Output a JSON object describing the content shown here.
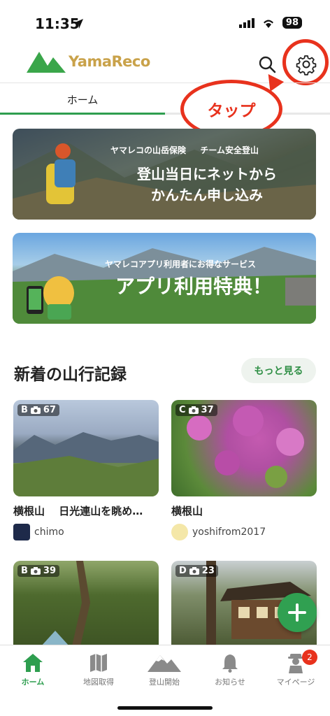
{
  "status": {
    "time": "11:35",
    "battery": "98"
  },
  "header": {
    "logo_text": "YamaReco"
  },
  "tabs": {
    "home": "ホーム"
  },
  "callout": {
    "text": "タップ"
  },
  "banners": {
    "insurance": {
      "sub": "ヤマレコの山岳保険 　 チーム安全登山",
      "main_line1": "登山当日にネットから",
      "main_line2": "かんたん申し込み"
    },
    "benefit": {
      "sub": "ヤマレコアプリ利用者にお得なサービス",
      "main": "アプリ利用特典！"
    }
  },
  "records_section": {
    "title": "新着の山行記録",
    "more_label": "もっと見る"
  },
  "records": [
    {
      "grade": "B",
      "photos": "67",
      "title": "横根山　 日光連山を眺め…",
      "user": "chimo"
    },
    {
      "grade": "C",
      "photos": "37",
      "title": "横根山",
      "user": "yoshifrom2017"
    },
    {
      "grade": "B",
      "photos": "39",
      "title": "",
      "user": ""
    },
    {
      "grade": "D",
      "photos": "23",
      "title": "",
      "user": ""
    }
  ],
  "bottom_nav": [
    {
      "label": "ホーム",
      "icon": "home-icon",
      "active": true
    },
    {
      "label": "地図取得",
      "icon": "map-icon",
      "active": false
    },
    {
      "label": "登山開始",
      "icon": "mountain-icon",
      "active": false
    },
    {
      "label": "お知らせ",
      "icon": "bell-icon",
      "active": false
    },
    {
      "label": "マイページ",
      "icon": "hiker-icon",
      "active": false,
      "badge": "2"
    }
  ],
  "colors": {
    "accent": "#2e9e4f",
    "callout": "#e8321d",
    "logo_text": "#c9a24a"
  }
}
